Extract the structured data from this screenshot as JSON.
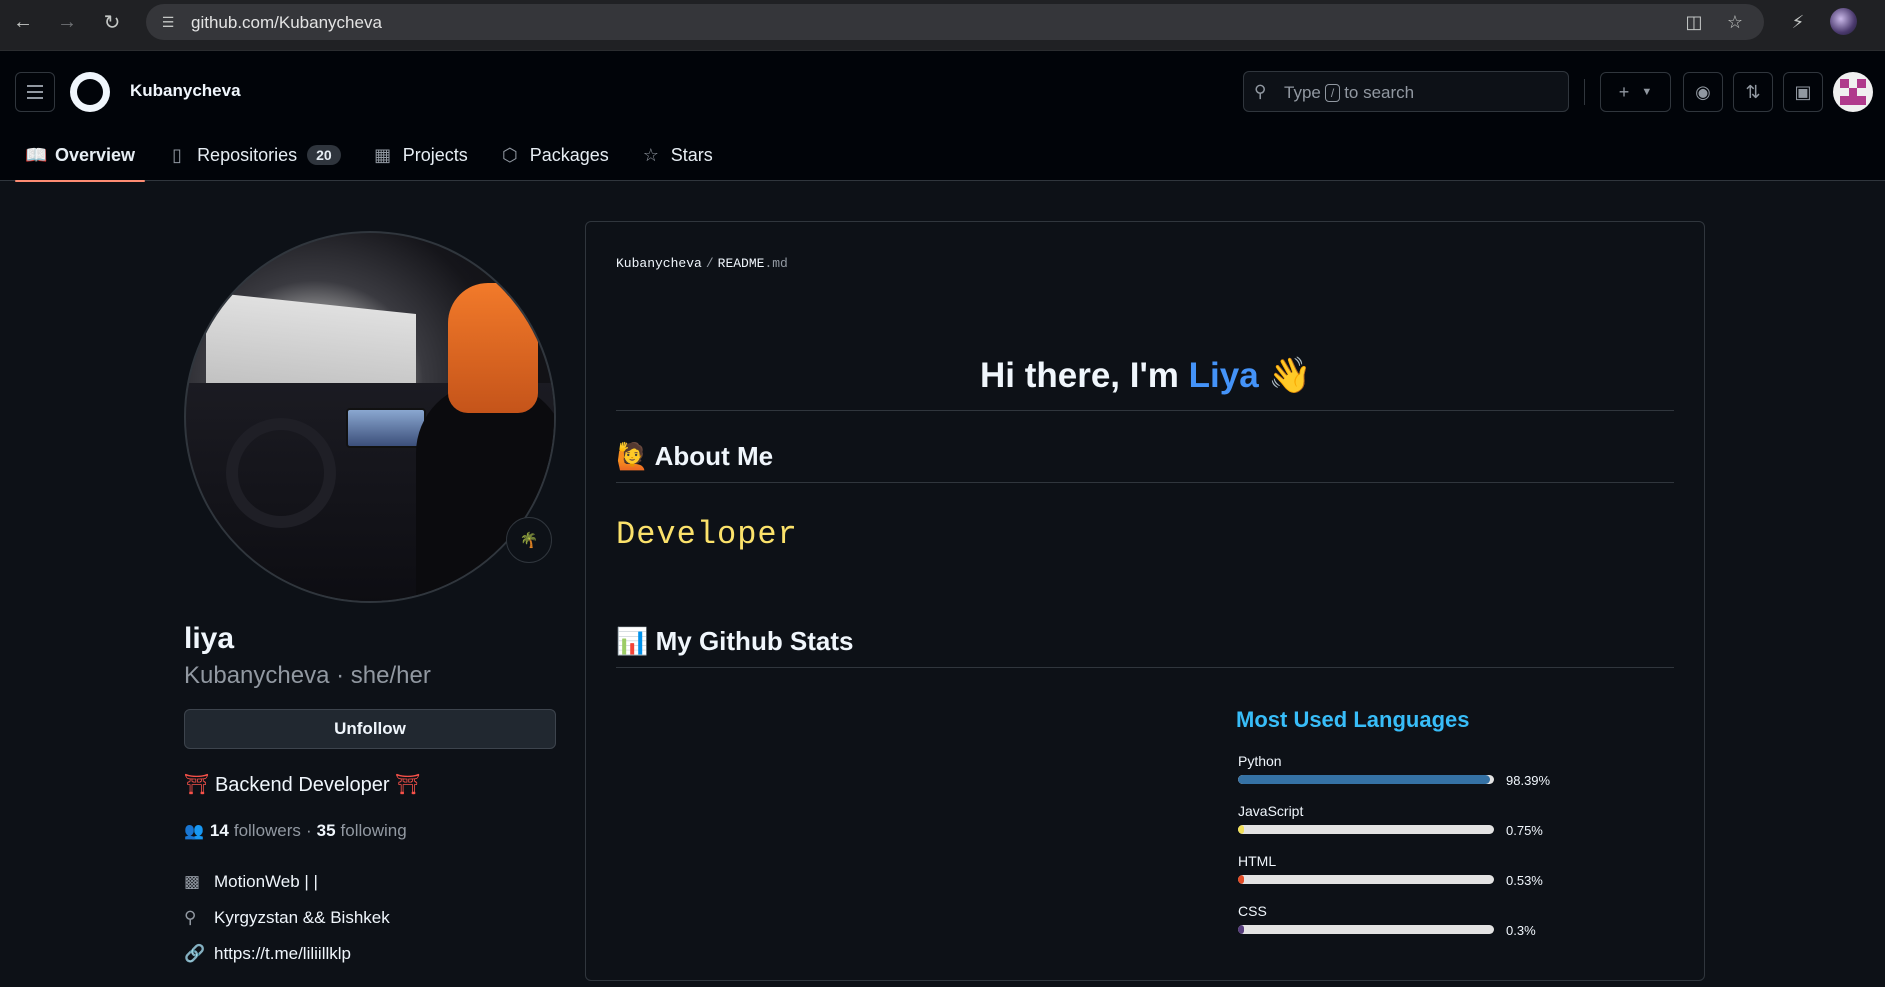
{
  "browser": {
    "url": "github.com/Kubanycheva"
  },
  "header": {
    "username": "Kubanycheva",
    "search_placeholder_pre": "Type",
    "search_key": "/",
    "search_placeholder_post": "to search",
    "new_label": "+"
  },
  "tabs": [
    {
      "label": "Overview",
      "icon": "book-icon"
    },
    {
      "label": "Repositories",
      "icon": "repo-icon",
      "count": "20"
    },
    {
      "label": "Projects",
      "icon": "table-icon"
    },
    {
      "label": "Packages",
      "icon": "package-icon"
    },
    {
      "label": "Stars",
      "icon": "star-icon"
    }
  ],
  "profile": {
    "status_emoji": "🌴",
    "name": "liya",
    "login_pronouns": "Kubanycheva · she/her",
    "follow_button": "Unfollow",
    "bio_icon": "⛩",
    "bio": "Backend Developer",
    "followers_count": "14",
    "followers_label": "followers",
    "following_count": "35",
    "following_label": "following",
    "company": "MotionWeb | |",
    "location": "Kyrgyzstan && Bishkek",
    "link": "https://t.me/liliillklp"
  },
  "readme": {
    "owner": "Kubanycheva",
    "file_base": "README",
    "file_ext": ".md",
    "title_pre": "Hi there, I'm",
    "title_name": "Liya",
    "title_emoji": "👋",
    "about_emoji": "🙋",
    "about_heading": "About Me",
    "developer_text": "Developer",
    "stats_emoji": "📊",
    "stats_heading": "My Github Stats"
  },
  "languages": {
    "title": "Most Used Languages",
    "items": [
      {
        "name": "Python",
        "percent": "98.39%",
        "value": 98.39,
        "color": "#3572A5"
      },
      {
        "name": "JavaScript",
        "percent": "0.75%",
        "value": 0.75,
        "color": "#f1e05a"
      },
      {
        "name": "HTML",
        "percent": "0.53%",
        "value": 0.53,
        "color": "#e34c26"
      },
      {
        "name": "CSS",
        "percent": "0.3%",
        "value": 0.3,
        "color": "#563d7c"
      }
    ]
  }
}
